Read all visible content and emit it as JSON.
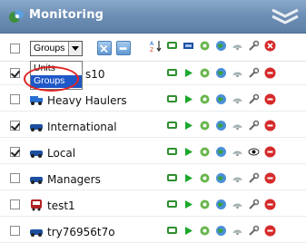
{
  "header": {
    "title": "Monitoring"
  },
  "toolbar": {
    "select_value": "Groups",
    "dropdown_options": [
      "Units",
      "Groups"
    ]
  },
  "rows": [
    {
      "label": "s10",
      "checked": true
    },
    {
      "label": "Heavy Haulers",
      "checked": false
    },
    {
      "label": "International",
      "checked": true
    },
    {
      "label": "Local",
      "checked": true
    },
    {
      "label": "Managers",
      "checked": false
    },
    {
      "label": "test1",
      "checked": false
    },
    {
      "label": "try76956t7o",
      "checked": false
    }
  ],
  "colors": {
    "header_blue": "#6f90b6",
    "selection_blue": "#1e57c8",
    "highlight_red": "#e02424"
  }
}
